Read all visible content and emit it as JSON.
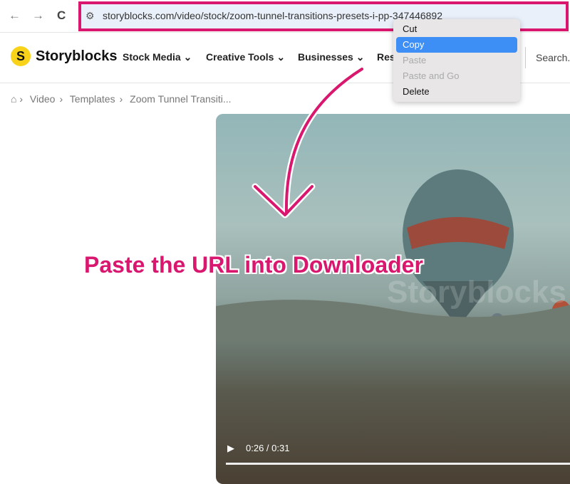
{
  "browser": {
    "back": "←",
    "forward": "→",
    "reload": "C",
    "url": "storyblocks.com/video/stock/zoom-tunnel-transitions-presets-i-pp-347446892"
  },
  "nav": {
    "brand": "Storyblocks",
    "logo_letter": "S",
    "items": [
      "Stock Media ⌄",
      "Creative Tools ⌄",
      "Businesses ⌄",
      "Res"
    ],
    "search_placeholder": "Search..."
  },
  "breadcrumb": [
    "Video",
    "Templates",
    "Zoom Tunnel Transiti..."
  ],
  "context_menu": [
    {
      "label": "Cut",
      "state": "normal"
    },
    {
      "label": "Copy",
      "state": "selected"
    },
    {
      "label": "Paste",
      "state": "disabled"
    },
    {
      "label": "Paste and Go",
      "state": "disabled"
    },
    {
      "label": "Delete",
      "state": "normal"
    }
  ],
  "video": {
    "time": "0:26 / 0:31",
    "watermark": "Storyblocks"
  },
  "annotation": {
    "caption": "Paste the URL into Downloader",
    "color": "#d9176f"
  }
}
